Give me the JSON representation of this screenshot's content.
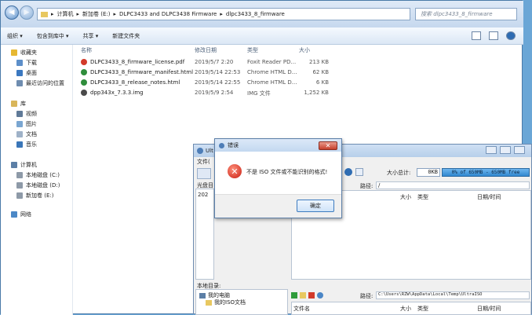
{
  "explorer": {
    "breadcrumb": [
      "计算机",
      "新加卷 (E:)",
      "DLPC3433 and DLPC3438 Firmware",
      "dlpc3433_8_firmware"
    ],
    "search_placeholder": "搜索 dlpc3433_8_firmware",
    "toolbar": [
      "组织 ▾",
      "包含到库中 ▾",
      "共享 ▾",
      "新建文件夹"
    ],
    "columns": {
      "name": "名称",
      "date": "修改日期",
      "type": "类型",
      "size": "大小"
    },
    "files": [
      {
        "name": "DLPC3433_8_firmware_license.pdf",
        "date": "2019/5/7 2:20",
        "type": "Foxit Reader PD...",
        "size": "213 KB",
        "color": "#d23a2a"
      },
      {
        "name": "DLPC3433_8_firmware_manifest.html",
        "date": "2019/5/14 22:53",
        "type": "Chrome HTML D...",
        "size": "62 KB",
        "color": "#2f8d3b"
      },
      {
        "name": "DLPC3433_8_release_notes.html",
        "date": "2019/5/14 22:55",
        "type": "Chrome HTML D...",
        "size": "6 KB",
        "color": "#2f8d3b"
      },
      {
        "name": "dpp343x_7.3.3.img",
        "date": "2019/5/9 2:54",
        "type": "IMG 文件",
        "size": "1,252 KB",
        "color": "#4a4a4a"
      }
    ],
    "nav": {
      "favorites": "收藏夹",
      "downloads": "下载",
      "desktop": "桌面",
      "recent": "最近访问的位置",
      "libraries": "库",
      "videos": "视频",
      "pictures": "图片",
      "documents": "文档",
      "music": "音乐",
      "computer": "计算机",
      "local_c": "本地磁盘 (C:)",
      "local_d": "本地磁盘 (D:)",
      "new_e": "新加卷 (E:)",
      "network": "网络"
    }
  },
  "ultraiso": {
    "title": "Ult",
    "file_menu": "文件(",
    "disc_label": "光盘目",
    "item_20": "202",
    "total_label": "大小总计:",
    "total_value": "0KB",
    "capacity": "0% of 650MB - 650MB free",
    "path_label": "路径:",
    "path_value": "/",
    "col_size": "大小",
    "col_type": "类型",
    "col_date": "日期/时间",
    "local_label": "本地目录:",
    "local_path_label": "路径:",
    "local_path": "C:\\Users\\RZW\\AppData\\Local\\Temp\\UltraISO",
    "col_filename": "文件名",
    "tree_mypc": "我的电脑",
    "tree_iso": "我的ISO文档",
    "tree_partial": "..."
  },
  "dialog": {
    "title": "错误",
    "close": "✕",
    "message": "不是 ISO 文件或不能识别的格式!",
    "ok": "确定"
  }
}
